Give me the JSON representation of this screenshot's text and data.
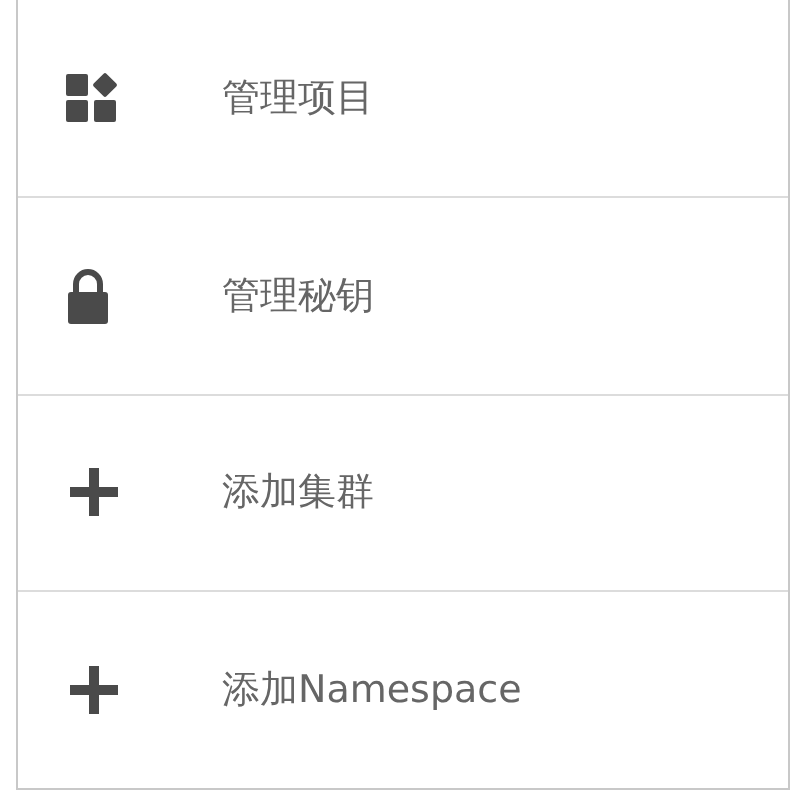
{
  "menu": {
    "items": [
      {
        "kind": "apps",
        "label": "管理项目"
      },
      {
        "kind": "lock",
        "label": "管理秘钥"
      },
      {
        "kind": "plus",
        "label": "添加集群"
      },
      {
        "kind": "plus",
        "label": "添加Namespace"
      }
    ]
  }
}
